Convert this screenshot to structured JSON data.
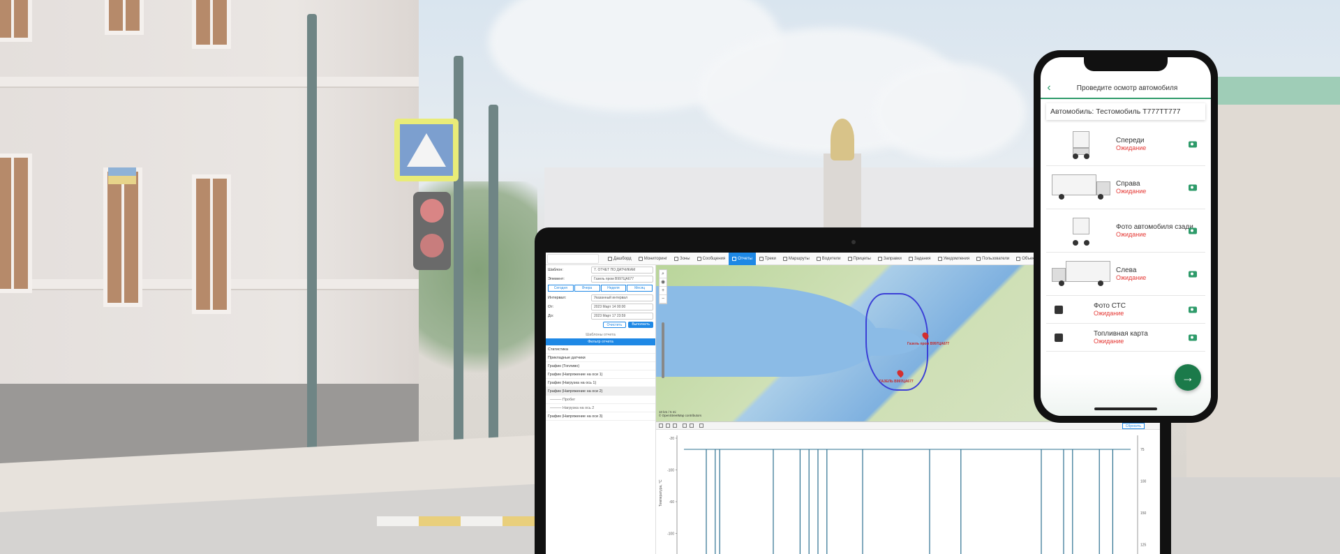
{
  "web_app": {
    "nav": [
      "Дашборд",
      "Мониторинг",
      "Зоны",
      "Сообщения",
      "Отчеты",
      "Треки",
      "Маршруты",
      "Водители",
      "Прицепы",
      "Заправки",
      "Задания",
      "Уведомления",
      "Пользователи",
      "Объекты"
    ],
    "active_nav_index": 4,
    "form": {
      "template_label": "Шаблон:",
      "template_value": "7. ОТЧЕТ ПО ДАТЧИКАМ",
      "object_label": "Элемент:",
      "object_value": "Газель пром В997ЦА677",
      "interval_label": "Интервал:",
      "interval_value": "Указанный интервал",
      "from_label": "От:",
      "from_value": "2023 Март 14 00:00",
      "to_label": "До:",
      "to_value": "2023 Март 17 23:59"
    },
    "period_tabs": [
      "Сегодня",
      "Вчера",
      "Неделя",
      "Месяц"
    ],
    "buttons": {
      "clear": "Очистить",
      "execute": "Выполнить"
    },
    "templates_header": "Шаблоны отчета",
    "templates_active": "Фильтр отчета",
    "report_items": [
      {
        "label": "Статистика",
        "sub": false,
        "hl": false
      },
      {
        "label": "Прикладные датчики",
        "sub": false,
        "hl": false
      },
      {
        "label": "График (Топливо)",
        "sub": false,
        "hl": false
      },
      {
        "label": "График (Напряжение на оси 1)",
        "sub": false,
        "hl": false
      },
      {
        "label": "График (Нагрузка на ось 1)",
        "sub": false,
        "hl": false
      },
      {
        "label": "График (Напряжение на оси 2)",
        "sub": false,
        "hl": true
      },
      {
        "label": "——— Пробег",
        "sub": true,
        "hl": false
      },
      {
        "label": "——— Нагрузка на ось 2",
        "sub": true,
        "hl": false
      },
      {
        "label": "График (Напряжение на оси 3)",
        "sub": false,
        "hl": false
      }
    ],
    "map": {
      "pins": [
        {
          "label": "Газель пром В997ЦА677"
        },
        {
          "label": "ГАЗЕЛЬ В997ЦА677"
        }
      ],
      "scale_text": "10 km / 5 mi",
      "copyright": "© OpenStreetMap contributors"
    },
    "chart_toolbar": {
      "reset": "Сбросить"
    },
    "chart_data": {
      "type": "line",
      "title": "",
      "xlabel": "",
      "ylabel": "Температура, °С",
      "y_ticks_left": [
        "-20",
        "-100",
        "-60",
        "-100"
      ],
      "y_ticks_right": [
        "75",
        "100",
        "150",
        "125"
      ],
      "spikes_x_fraction": [
        0.05,
        0.07,
        0.08,
        0.2,
        0.26,
        0.28,
        0.3,
        0.32,
        0.4,
        0.55,
        0.62,
        0.8,
        0.85,
        0.87,
        0.93,
        0.96
      ],
      "baseline": -20
    }
  },
  "phone_app": {
    "title": "Проведите осмотр автомобиля",
    "vehicle": "Автомобиль: Тестомобиль Т777ТТ777",
    "items": [
      {
        "label": "Спереди",
        "status": "Ожидание",
        "icon": "truck-front-icon"
      },
      {
        "label": "Справа",
        "status": "Ожидание",
        "icon": "truck-right-icon"
      },
      {
        "label": "Фото автомобиля сзади",
        "status": "Ожидание",
        "icon": "truck-back-icon"
      },
      {
        "label": "Слева",
        "status": "Ожидание",
        "icon": "truck-left-icon"
      },
      {
        "label": "Фото СТС",
        "status": "Ожидание",
        "icon": "document-icon"
      },
      {
        "label": "Топливная карта",
        "status": "Ожидание",
        "icon": "fuel-card-icon"
      }
    ],
    "fab": "→",
    "colors": {
      "accent": "#2e9b6a",
      "status": "#e53935"
    }
  }
}
